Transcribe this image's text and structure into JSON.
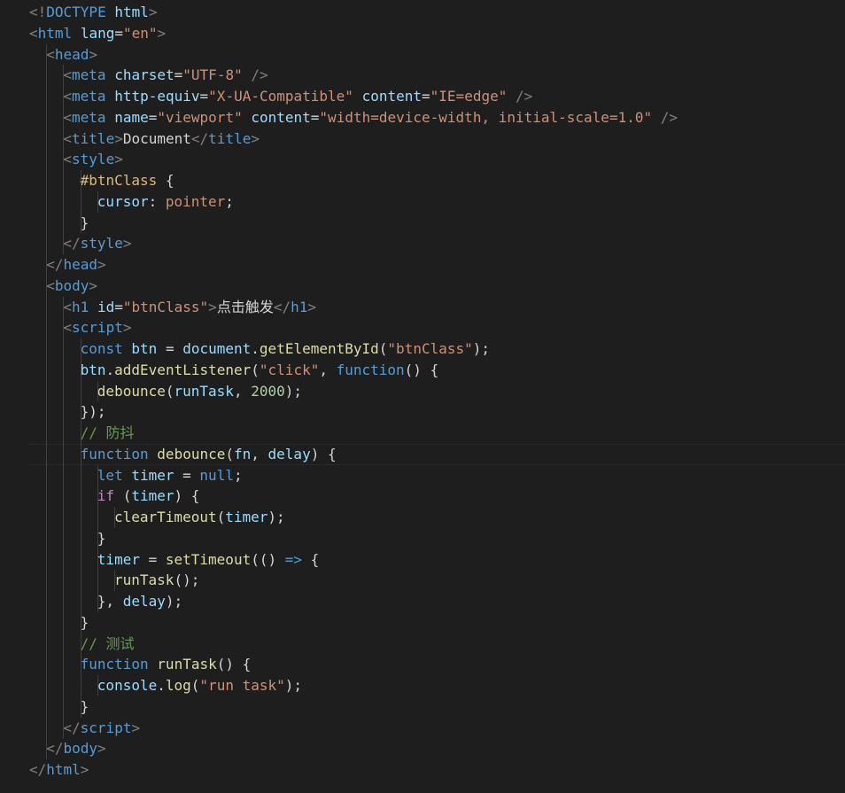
{
  "editor": {
    "language": "html",
    "current_line": 21,
    "lines": [
      {
        "indent": 0,
        "tokens": [
          {
            "t": "<!",
            "c": "punct"
          },
          {
            "t": "DOCTYPE",
            "c": "tag"
          },
          {
            "t": " html",
            "c": "attr"
          },
          {
            "t": ">",
            "c": "punct"
          }
        ]
      },
      {
        "indent": 0,
        "tokens": [
          {
            "t": "<",
            "c": "punct"
          },
          {
            "t": "html",
            "c": "tag"
          },
          {
            "t": " ",
            "c": "text"
          },
          {
            "t": "lang",
            "c": "attr"
          },
          {
            "t": "=",
            "c": "text"
          },
          {
            "t": "\"en\"",
            "c": "str"
          },
          {
            "t": ">",
            "c": "punct"
          }
        ]
      },
      {
        "indent": 1,
        "tokens": [
          {
            "t": "<",
            "c": "punct"
          },
          {
            "t": "head",
            "c": "tag"
          },
          {
            "t": ">",
            "c": "punct"
          }
        ]
      },
      {
        "indent": 2,
        "tokens": [
          {
            "t": "<",
            "c": "punct"
          },
          {
            "t": "meta",
            "c": "tag"
          },
          {
            "t": " ",
            "c": "text"
          },
          {
            "t": "charset",
            "c": "attr"
          },
          {
            "t": "=",
            "c": "text"
          },
          {
            "t": "\"UTF-8\"",
            "c": "str"
          },
          {
            "t": " />",
            "c": "punct"
          }
        ]
      },
      {
        "indent": 2,
        "tokens": [
          {
            "t": "<",
            "c": "punct"
          },
          {
            "t": "meta",
            "c": "tag"
          },
          {
            "t": " ",
            "c": "text"
          },
          {
            "t": "http-equiv",
            "c": "attr"
          },
          {
            "t": "=",
            "c": "text"
          },
          {
            "t": "\"X-UA-Compatible\"",
            "c": "str"
          },
          {
            "t": " ",
            "c": "text"
          },
          {
            "t": "content",
            "c": "attr"
          },
          {
            "t": "=",
            "c": "text"
          },
          {
            "t": "\"IE=edge\"",
            "c": "str"
          },
          {
            "t": " />",
            "c": "punct"
          }
        ]
      },
      {
        "indent": 2,
        "tokens": [
          {
            "t": "<",
            "c": "punct"
          },
          {
            "t": "meta",
            "c": "tag"
          },
          {
            "t": " ",
            "c": "text"
          },
          {
            "t": "name",
            "c": "attr"
          },
          {
            "t": "=",
            "c": "text"
          },
          {
            "t": "\"viewport\"",
            "c": "str"
          },
          {
            "t": " ",
            "c": "text"
          },
          {
            "t": "content",
            "c": "attr"
          },
          {
            "t": "=",
            "c": "text"
          },
          {
            "t": "\"width=device-width, initial-scale=1.0\"",
            "c": "str"
          },
          {
            "t": " />",
            "c": "punct"
          }
        ]
      },
      {
        "indent": 2,
        "tokens": [
          {
            "t": "<",
            "c": "punct"
          },
          {
            "t": "title",
            "c": "tag"
          },
          {
            "t": ">",
            "c": "punct"
          },
          {
            "t": "Document",
            "c": "text"
          },
          {
            "t": "</",
            "c": "punct"
          },
          {
            "t": "title",
            "c": "tag"
          },
          {
            "t": ">",
            "c": "punct"
          }
        ]
      },
      {
        "indent": 2,
        "tokens": [
          {
            "t": "<",
            "c": "punct"
          },
          {
            "t": "style",
            "c": "tag"
          },
          {
            "t": ">",
            "c": "punct"
          }
        ]
      },
      {
        "indent": 3,
        "tokens": [
          {
            "t": "#btnClass",
            "c": "selector"
          },
          {
            "t": " {",
            "c": "text"
          }
        ]
      },
      {
        "indent": 4,
        "tokens": [
          {
            "t": "cursor",
            "c": "prop"
          },
          {
            "t": ": ",
            "c": "text"
          },
          {
            "t": "pointer",
            "c": "str"
          },
          {
            "t": ";",
            "c": "text"
          }
        ]
      },
      {
        "indent": 3,
        "tokens": [
          {
            "t": "}",
            "c": "text"
          }
        ]
      },
      {
        "indent": 2,
        "tokens": [
          {
            "t": "</",
            "c": "punct"
          },
          {
            "t": "style",
            "c": "tag"
          },
          {
            "t": ">",
            "c": "punct"
          }
        ]
      },
      {
        "indent": 1,
        "tokens": [
          {
            "t": "</",
            "c": "punct"
          },
          {
            "t": "head",
            "c": "tag"
          },
          {
            "t": ">",
            "c": "punct"
          }
        ]
      },
      {
        "indent": 1,
        "tokens": [
          {
            "t": "<",
            "c": "punct"
          },
          {
            "t": "body",
            "c": "tag"
          },
          {
            "t": ">",
            "c": "punct"
          }
        ]
      },
      {
        "indent": 2,
        "tokens": [
          {
            "t": "<",
            "c": "punct"
          },
          {
            "t": "h1",
            "c": "tag"
          },
          {
            "t": " ",
            "c": "text"
          },
          {
            "t": "id",
            "c": "attr"
          },
          {
            "t": "=",
            "c": "text"
          },
          {
            "t": "\"btnClass\"",
            "c": "str"
          },
          {
            "t": ">",
            "c": "punct"
          },
          {
            "t": "点击触发",
            "c": "text"
          },
          {
            "t": "</",
            "c": "punct"
          },
          {
            "t": "h1",
            "c": "tag"
          },
          {
            "t": ">",
            "c": "punct"
          }
        ]
      },
      {
        "indent": 2,
        "tokens": [
          {
            "t": "<",
            "c": "punct"
          },
          {
            "t": "script",
            "c": "tag"
          },
          {
            "t": ">",
            "c": "punct"
          }
        ]
      },
      {
        "indent": 3,
        "tokens": [
          {
            "t": "const",
            "c": "kw"
          },
          {
            "t": " ",
            "c": "text"
          },
          {
            "t": "btn",
            "c": "var"
          },
          {
            "t": " = ",
            "c": "text"
          },
          {
            "t": "document",
            "c": "var"
          },
          {
            "t": ".",
            "c": "text"
          },
          {
            "t": "getElementById",
            "c": "fn"
          },
          {
            "t": "(",
            "c": "text"
          },
          {
            "t": "\"btnClass\"",
            "c": "str"
          },
          {
            "t": ");",
            "c": "text"
          }
        ]
      },
      {
        "indent": 3,
        "tokens": [
          {
            "t": "btn",
            "c": "var"
          },
          {
            "t": ".",
            "c": "text"
          },
          {
            "t": "addEventListener",
            "c": "fn"
          },
          {
            "t": "(",
            "c": "text"
          },
          {
            "t": "\"click\"",
            "c": "str"
          },
          {
            "t": ", ",
            "c": "text"
          },
          {
            "t": "function",
            "c": "kw"
          },
          {
            "t": "() {",
            "c": "text"
          }
        ]
      },
      {
        "indent": 4,
        "tokens": [
          {
            "t": "debounce",
            "c": "fn"
          },
          {
            "t": "(",
            "c": "text"
          },
          {
            "t": "runTask",
            "c": "var"
          },
          {
            "t": ", ",
            "c": "text"
          },
          {
            "t": "2000",
            "c": "num"
          },
          {
            "t": ");",
            "c": "text"
          }
        ]
      },
      {
        "indent": 3,
        "tokens": [
          {
            "t": "});",
            "c": "text"
          }
        ]
      },
      {
        "indent": 3,
        "tokens": [
          {
            "t": "// 防抖",
            "c": "comment"
          }
        ]
      },
      {
        "indent": 3,
        "tokens": [
          {
            "t": "function",
            "c": "kw"
          },
          {
            "t": " ",
            "c": "text"
          },
          {
            "t": "debounce",
            "c": "fn"
          },
          {
            "t": "(",
            "c": "text"
          },
          {
            "t": "fn",
            "c": "var"
          },
          {
            "t": ", ",
            "c": "text"
          },
          {
            "t": "delay",
            "c": "var"
          },
          {
            "t": ") {",
            "c": "text"
          }
        ]
      },
      {
        "indent": 4,
        "tokens": [
          {
            "t": "let",
            "c": "kw"
          },
          {
            "t": " ",
            "c": "text"
          },
          {
            "t": "timer",
            "c": "var"
          },
          {
            "t": " = ",
            "c": "text"
          },
          {
            "t": "null",
            "c": "kw"
          },
          {
            "t": ";",
            "c": "text"
          }
        ]
      },
      {
        "indent": 4,
        "tokens": [
          {
            "t": "if",
            "c": "ctrl"
          },
          {
            "t": " (",
            "c": "text"
          },
          {
            "t": "timer",
            "c": "var"
          },
          {
            "t": ") {",
            "c": "text"
          }
        ]
      },
      {
        "indent": 5,
        "tokens": [
          {
            "t": "clearTimeout",
            "c": "fn"
          },
          {
            "t": "(",
            "c": "text"
          },
          {
            "t": "timer",
            "c": "var"
          },
          {
            "t": ");",
            "c": "text"
          }
        ]
      },
      {
        "indent": 4,
        "tokens": [
          {
            "t": "}",
            "c": "text"
          }
        ]
      },
      {
        "indent": 4,
        "tokens": [
          {
            "t": "timer",
            "c": "var"
          },
          {
            "t": " = ",
            "c": "text"
          },
          {
            "t": "setTimeout",
            "c": "fn"
          },
          {
            "t": "(() ",
            "c": "text"
          },
          {
            "t": "=>",
            "c": "kw"
          },
          {
            "t": " {",
            "c": "text"
          }
        ]
      },
      {
        "indent": 5,
        "tokens": [
          {
            "t": "runTask",
            "c": "fn"
          },
          {
            "t": "();",
            "c": "text"
          }
        ]
      },
      {
        "indent": 4,
        "tokens": [
          {
            "t": "}, ",
            "c": "text"
          },
          {
            "t": "delay",
            "c": "var"
          },
          {
            "t": ");",
            "c": "text"
          }
        ]
      },
      {
        "indent": 3,
        "tokens": [
          {
            "t": "}",
            "c": "text"
          }
        ]
      },
      {
        "indent": 3,
        "tokens": [
          {
            "t": "// 测试",
            "c": "comment"
          }
        ]
      },
      {
        "indent": 3,
        "tokens": [
          {
            "t": "function",
            "c": "kw"
          },
          {
            "t": " ",
            "c": "text"
          },
          {
            "t": "runTask",
            "c": "fn"
          },
          {
            "t": "() {",
            "c": "text"
          }
        ]
      },
      {
        "indent": 4,
        "tokens": [
          {
            "t": "console",
            "c": "var"
          },
          {
            "t": ".",
            "c": "text"
          },
          {
            "t": "log",
            "c": "fn"
          },
          {
            "t": "(",
            "c": "text"
          },
          {
            "t": "\"run task\"",
            "c": "str"
          },
          {
            "t": ");",
            "c": "text"
          }
        ]
      },
      {
        "indent": 3,
        "tokens": [
          {
            "t": "}",
            "c": "text"
          }
        ]
      },
      {
        "indent": 2,
        "tokens": [
          {
            "t": "</",
            "c": "punct"
          },
          {
            "t": "script",
            "c": "tag"
          },
          {
            "t": ">",
            "c": "punct"
          }
        ]
      },
      {
        "indent": 1,
        "tokens": [
          {
            "t": "</",
            "c": "punct"
          },
          {
            "t": "body",
            "c": "tag"
          },
          {
            "t": ">",
            "c": "punct"
          }
        ]
      },
      {
        "indent": 0,
        "tokens": [
          {
            "t": "</",
            "c": "punct"
          },
          {
            "t": "html",
            "c": "tag"
          },
          {
            "t": ">",
            "c": "punct"
          }
        ]
      }
    ]
  },
  "colors": {
    "background": "#1e1e1e",
    "tag": "#569cd6",
    "punct": "#808080",
    "attr": "#9cdcfe",
    "string": "#ce9178",
    "comment": "#6a9955",
    "function": "#dcdcaa",
    "number": "#b5cea8",
    "control": "#c586c0",
    "selector": "#d7ba7d"
  }
}
